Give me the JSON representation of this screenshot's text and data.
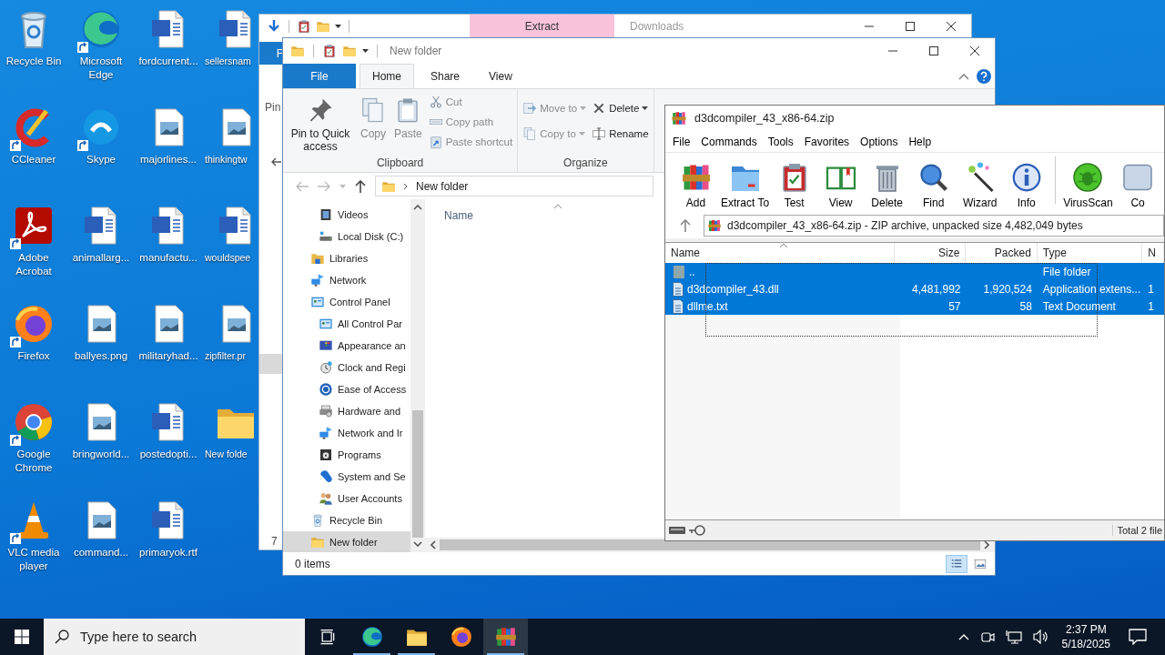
{
  "desktop_icons": [
    {
      "label": "Recycle Bin",
      "kind": "recycle-bin",
      "shortcut": false
    },
    {
      "label": "Microsoft Edge",
      "kind": "edge",
      "shortcut": true
    },
    {
      "label": "fordcurrent...",
      "kind": "word",
      "shortcut": false
    },
    {
      "label": "sellersnam",
      "kind": "word",
      "shortcut": false
    },
    {
      "label": "CCleaner",
      "kind": "ccleaner",
      "shortcut": true
    },
    {
      "label": "Skype",
      "kind": "skype",
      "shortcut": true
    },
    {
      "label": "majorlines...",
      "kind": "image",
      "shortcut": false
    },
    {
      "label": "thinkingtw",
      "kind": "image",
      "shortcut": false
    },
    {
      "label": "Adobe Acrobat",
      "kind": "acrobat",
      "shortcut": true
    },
    {
      "label": "animallarg...",
      "kind": "word",
      "shortcut": false
    },
    {
      "label": "manufactu...",
      "kind": "word",
      "shortcut": false
    },
    {
      "label": "wouldspee",
      "kind": "word",
      "shortcut": false
    },
    {
      "label": "Firefox",
      "kind": "firefox",
      "shortcut": true
    },
    {
      "label": "ballyes.png",
      "kind": "image",
      "shortcut": false
    },
    {
      "label": "militaryhad...",
      "kind": "image",
      "shortcut": false
    },
    {
      "label": "zipfilter.pr",
      "kind": "image",
      "shortcut": false
    },
    {
      "label": "Google Chrome",
      "kind": "chrome",
      "shortcut": true
    },
    {
      "label": "bringworld...",
      "kind": "image",
      "shortcut": false
    },
    {
      "label": "postedopti...",
      "kind": "word",
      "shortcut": false
    },
    {
      "label": "New folde",
      "kind": "folder",
      "shortcut": false
    },
    {
      "label": "VLC media player",
      "kind": "vlc",
      "shortcut": true
    },
    {
      "label": "command...",
      "kind": "image",
      "shortcut": false
    },
    {
      "label": "primaryok.rtf",
      "kind": "word",
      "shortcut": false
    }
  ],
  "back_window": {
    "context_tab": "Extract",
    "title": "Downloads",
    "file_tab": "F",
    "ribbon_text": "Pin",
    "status": "7"
  },
  "explorer": {
    "title": "New folder",
    "ribbon_tabs": [
      {
        "label": "File",
        "kind": "file",
        "selected": false
      },
      {
        "label": "Home",
        "kind": "tab",
        "selected": true
      },
      {
        "label": "Share",
        "kind": "tab",
        "selected": false
      },
      {
        "label": "View",
        "kind": "tab",
        "selected": false
      }
    ],
    "groups": [
      {
        "label": "Clipboard",
        "large_buttons": [
          {
            "label": "Pin to Quick access",
            "kind": "pin",
            "disabled": false
          },
          {
            "label": "Copy",
            "kind": "copy",
            "disabled": true
          },
          {
            "label": "Paste",
            "kind": "paste",
            "disabled": true
          }
        ],
        "small_columns": [
          [
            {
              "label": "Cut",
              "kind": "cut",
              "disabled": true,
              "has_menu": false
            },
            {
              "label": "Copy path",
              "kind": "copy-path",
              "disabled": true,
              "has_menu": false
            },
            {
              "label": "Paste shortcut",
              "kind": "paste-shortcut",
              "disabled": true,
              "has_menu": false
            }
          ]
        ]
      },
      {
        "label": "Organize",
        "small_columns": [
          [
            {
              "label": "Move to",
              "kind": "move-to",
              "disabled": true,
              "has_menu": true
            },
            {
              "label": "Copy to",
              "kind": "copy-to",
              "disabled": true,
              "has_menu": true
            }
          ],
          [
            {
              "label": "Delete",
              "kind": "delete",
              "disabled": false,
              "has_menu": true
            },
            {
              "label": "Rename",
              "kind": "rename",
              "disabled": false,
              "has_menu": false
            }
          ]
        ]
      }
    ],
    "address": "New folder",
    "nav_pane": {
      "continued_items": [
        {
          "label": "Videos",
          "kind": "video",
          "selected": false
        },
        {
          "label": "Local Disk (C:)",
          "kind": "disk",
          "selected": false
        }
      ],
      "items": [
        {
          "label": "Libraries",
          "kind": "libraries",
          "selected": false
        },
        {
          "label": "Network",
          "kind": "network",
          "selected": false
        },
        {
          "label": "Control Panel",
          "kind": "control-panel",
          "selected": false,
          "children": [
            {
              "label": "All Control Par",
              "kind": "control-panel",
              "selected": false
            },
            {
              "label": "Appearance an",
              "kind": "appearance",
              "selected": false
            },
            {
              "label": "Clock and Regi",
              "kind": "clock",
              "selected": false
            },
            {
              "label": "Ease of Access",
              "kind": "ease",
              "selected": false
            },
            {
              "label": "Hardware and",
              "kind": "hardware",
              "selected": false
            },
            {
              "label": "Network and Ir",
              "kind": "net-internet",
              "selected": false
            },
            {
              "label": "Programs",
              "kind": "programs",
              "selected": false
            },
            {
              "label": "System and Se",
              "kind": "system",
              "selected": false
            },
            {
              "label": "User Accounts",
              "kind": "users",
              "selected": false
            }
          ]
        },
        {
          "label": "Recycle Bin",
          "kind": "recycle-small",
          "selected": false
        },
        {
          "label": "New folder",
          "kind": "folder",
          "selected": true
        }
      ]
    },
    "columns": [
      "Name"
    ],
    "status": "0 items",
    "view_buttons": [
      {
        "kind": "details",
        "selected": true
      },
      {
        "kind": "thumbnails",
        "selected": false
      }
    ]
  },
  "winrar": {
    "title": "d3dcompiler_43_x86-64.zip",
    "menu": [
      "File",
      "Commands",
      "Tools",
      "Favorites",
      "Options",
      "Help"
    ],
    "toolbar": [
      {
        "label": "Add",
        "kind": "add"
      },
      {
        "label": "Extract To",
        "kind": "extract"
      },
      {
        "label": "Test",
        "kind": "test"
      },
      {
        "label": "View",
        "kind": "view"
      },
      {
        "label": "Delete",
        "kind": "delete"
      },
      {
        "label": "Find",
        "kind": "find"
      },
      {
        "label": "Wizard",
        "kind": "wizard"
      },
      {
        "label": "Info",
        "kind": "info"
      },
      {
        "label": "VirusScan",
        "kind": "virusscan"
      },
      {
        "label": "Co",
        "kind": "comment"
      }
    ],
    "address": "d3dcompiler_43_x86-64.zip - ZIP archive, unpacked size 4,482,049 bytes",
    "columns": [
      "Name",
      "Size",
      "Packed",
      "Type",
      "N"
    ],
    "rows": [
      {
        "name": "..",
        "size": "",
        "packed": "",
        "type": "File folder",
        "column_5": "",
        "kind": "folder",
        "selected": true
      },
      {
        "name": "d3dcompiler_43.dll",
        "size": "4,481,992",
        "packed": "1,920,524",
        "type": "Application extens...",
        "column_5": "1",
        "kind": "file",
        "selected": true
      },
      {
        "name": "dllme.txt",
        "size": "57",
        "packed": "58",
        "type": "Text Document",
        "column_5": "1",
        "kind": "file",
        "selected": true
      }
    ],
    "status": "Total 2 file"
  },
  "taskbar": {
    "search_placeholder": "Type here to search",
    "apps": [
      {
        "kind": "task-view",
        "running": false,
        "selected": false
      },
      {
        "kind": "edge",
        "running": true,
        "selected": false
      },
      {
        "kind": "explorer",
        "running": true,
        "selected": false
      },
      {
        "kind": "firefox",
        "running": false,
        "selected": false
      },
      {
        "kind": "winrar",
        "running": true,
        "selected": true
      }
    ],
    "time": "2:37 PM",
    "date": "5/18/2025"
  }
}
